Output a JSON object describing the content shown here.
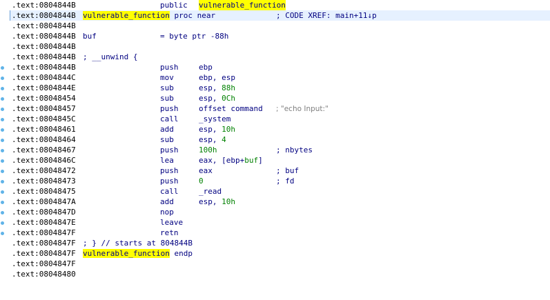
{
  "lines": [
    {
      "addr": ".text:0804844B",
      "mnem": "public",
      "ops_name": "vulnerable_function"
    },
    {
      "addr": ".text:0804844B",
      "label": "vulnerable_function",
      "label_rest": " proc near",
      "comment": "; CODE XREF: main+11↓p"
    },
    {
      "addr": ".text:0804844B"
    },
    {
      "addr": ".text:0804844B",
      "var": "buf",
      "var_def": "= byte ptr -88h"
    },
    {
      "addr": ".text:0804844B"
    },
    {
      "addr": ".text:0804844B",
      "label_text": "; __unwind {"
    },
    {
      "addr": ".text:0804844B",
      "mnem": "push",
      "op1": "ebp"
    },
    {
      "addr": ".text:0804844C",
      "mnem": "mov",
      "op1": "ebp, esp"
    },
    {
      "addr": ".text:0804844E",
      "mnem": "sub",
      "op1": "esp, ",
      "op1n": "88h"
    },
    {
      "addr": ".text:08048454",
      "mnem": "sub",
      "op1": "esp, ",
      "op1n": "0Ch"
    },
    {
      "addr": ".text:08048457",
      "mnem": "push",
      "op1": "offset command",
      "comment_str": "; \"echo Input:\""
    },
    {
      "addr": ".text:0804845C",
      "mnem": "call",
      "op1": "_system"
    },
    {
      "addr": ".text:08048461",
      "mnem": "add",
      "op1": "esp, ",
      "op1n": "10h"
    },
    {
      "addr": ".text:08048464",
      "mnem": "sub",
      "op1": "esp, ",
      "op1n": "4"
    },
    {
      "addr": ".text:08048467",
      "mnem": "push",
      "op1n": "100h",
      "comment": "; nbytes"
    },
    {
      "addr": ".text:0804846C",
      "mnem": "lea",
      "op1": "eax, [ebp+",
      "op1n": "buf",
      "op1_tail": "]"
    },
    {
      "addr": ".text:08048472",
      "mnem": "push",
      "op1": "eax",
      "comment": "; buf"
    },
    {
      "addr": ".text:08048473",
      "mnem": "push",
      "op1n": "0",
      "comment": "; fd"
    },
    {
      "addr": ".text:08048475",
      "mnem": "call",
      "op1": "_read"
    },
    {
      "addr": ".text:0804847A",
      "mnem": "add",
      "op1": "esp, ",
      "op1n": "10h"
    },
    {
      "addr": ".text:0804847D",
      "mnem": "nop"
    },
    {
      "addr": ".text:0804847E",
      "mnem": "leave"
    },
    {
      "addr": ".text:0804847F",
      "mnem": "retn"
    },
    {
      "addr": ".text:0804847F",
      "label_text": "; } // starts at 804844B"
    },
    {
      "addr": ".text:0804847F",
      "label": "vulnerable_function",
      "label_rest": " endp"
    },
    {
      "addr": ".text:0804847F"
    },
    {
      "addr": ".text:08048480"
    }
  ],
  "theme": {
    "highlight": "#ffff00",
    "code": "#000080",
    "number": "#008000",
    "comment_string": "#808080",
    "current_line": "#e6f1ff",
    "gutter_dot": "#5fb3e8"
  }
}
